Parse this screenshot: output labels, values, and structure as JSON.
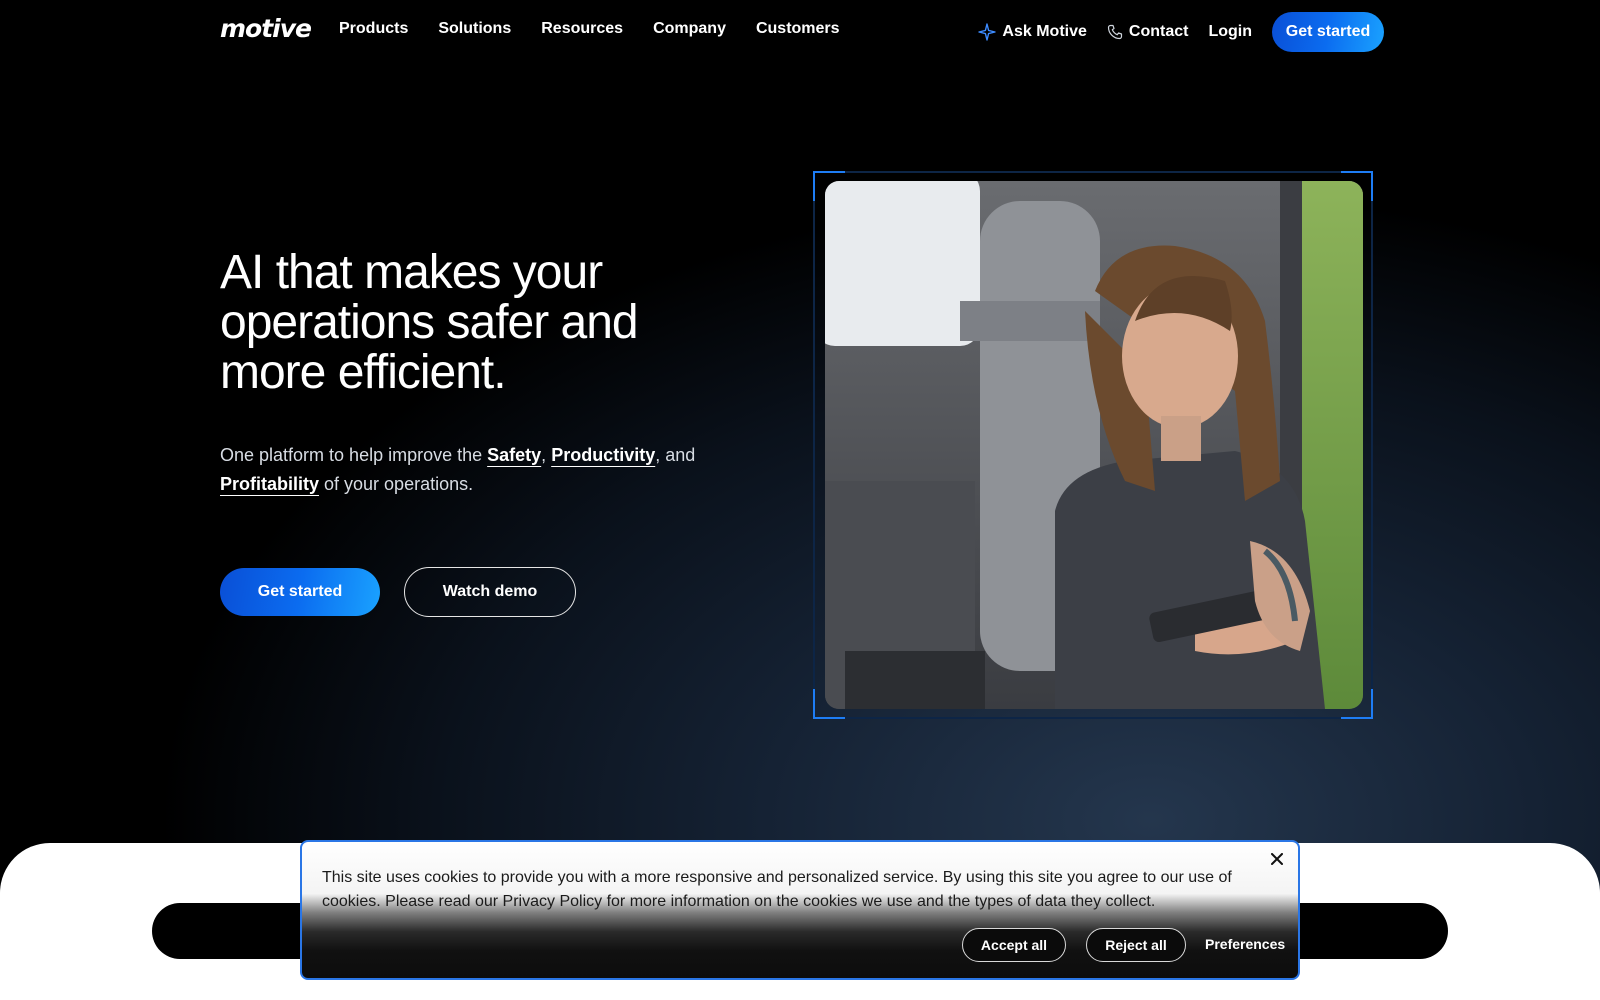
{
  "nav": {
    "logo": "motive",
    "links": [
      "Products",
      "Solutions",
      "Resources",
      "Company",
      "Customers"
    ],
    "ask": "Ask Motive",
    "contact": "Contact",
    "login": "Login",
    "cta": "Get started"
  },
  "hero": {
    "title": "AI that makes your operations safer and more efficient.",
    "sub_1": "One platform to help improve the ",
    "safety": "Safety",
    "comma": ", ",
    "productivity": "Productivity",
    "and": ", and ",
    "profitability": "Profitability",
    "sub_2": " of your operations.",
    "cta": "Get started",
    "demo": "Watch demo"
  },
  "cookie": {
    "text": "This site uses cookies to provide you with a more responsive and personalized service. By using this site you agree to our use of cookies. Please read our Privacy Policy for more information on the cookies we use and the types of data they collect.",
    "accept": "Accept all",
    "reject": "Reject all",
    "preferences": "Preferences"
  },
  "colors": {
    "accent": "#0b6cf0",
    "frame_corner": "#1e7df5"
  }
}
